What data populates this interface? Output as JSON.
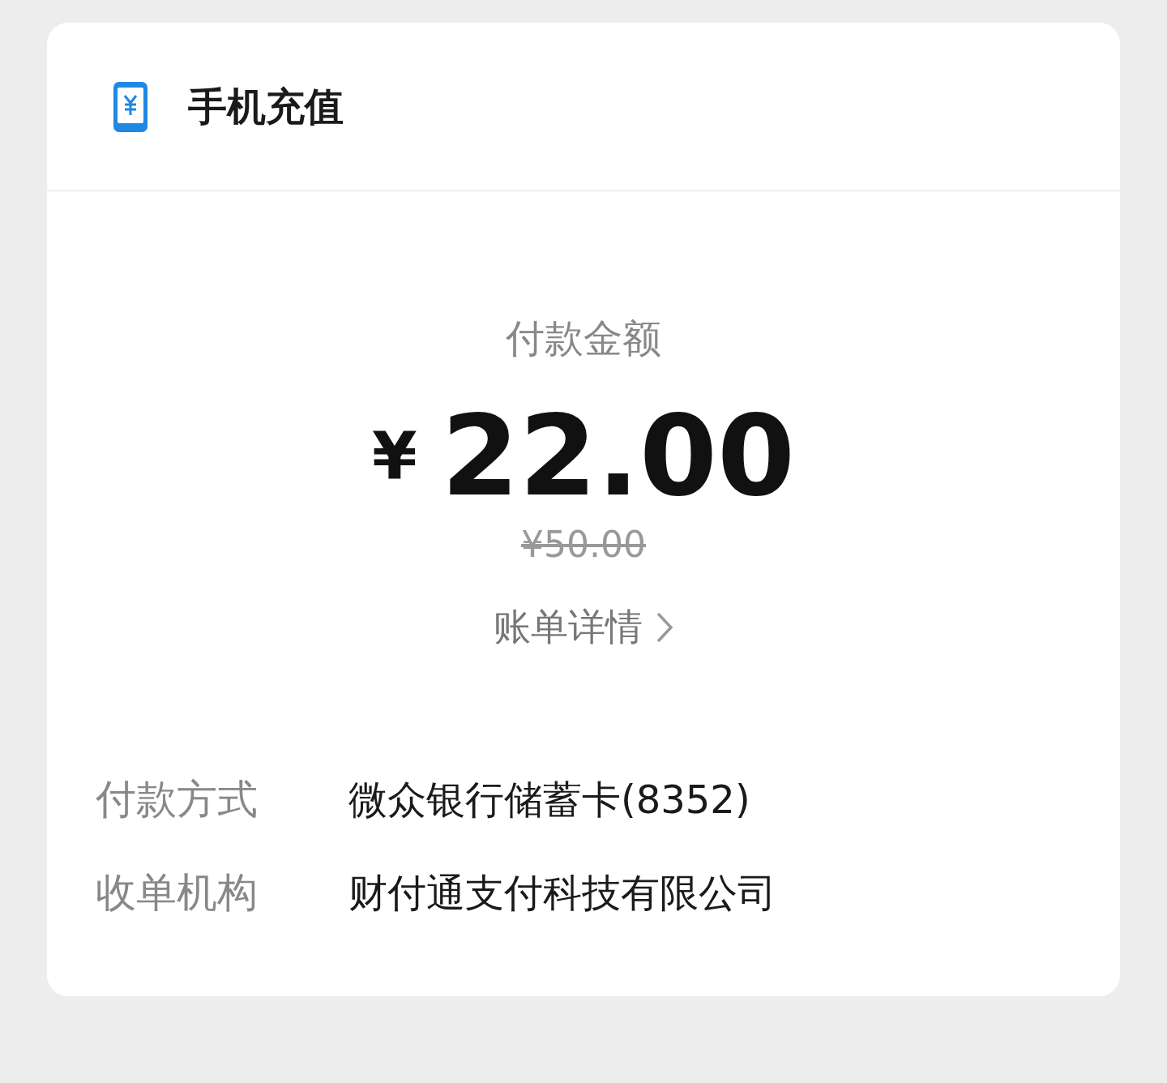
{
  "header": {
    "title": "手机充值"
  },
  "payment": {
    "label": "付款金额",
    "currency": "¥",
    "amount": "22.00",
    "original_price": "¥50.00",
    "details_link": "账单详情"
  },
  "info_rows": [
    {
      "label": "付款方式",
      "value": "微众银行储蓄卡(8352)"
    },
    {
      "label": "收单机构",
      "value": "财付通支付科技有限公司"
    }
  ]
}
